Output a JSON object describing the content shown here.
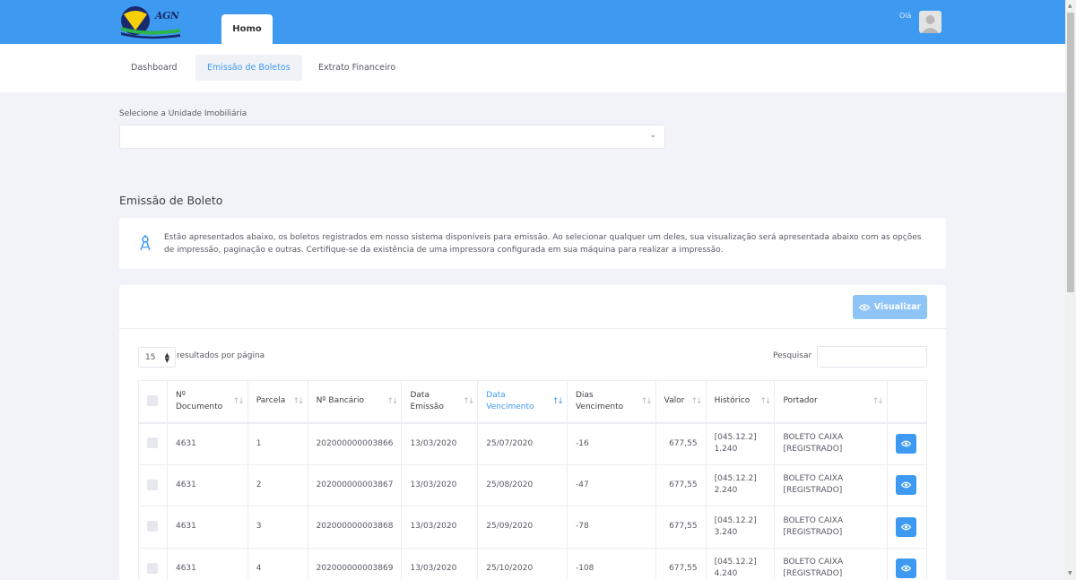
{
  "header": {
    "logo_text": "AGN",
    "home_tab": "Homo",
    "greeting": "Olá"
  },
  "subnav": {
    "items": [
      {
        "label": "Dashboard",
        "active": false
      },
      {
        "label": "Emissão de Boletos",
        "active": true
      },
      {
        "label": "Extrato Financeiro",
        "active": false
      }
    ]
  },
  "unit_select": {
    "label": "Selecione a Unidade Imobiliária",
    "value": ""
  },
  "section_title": "Emissão de Boleto",
  "info": {
    "text": "Estão apresentados abaixo, os boletos registrados em nosso sistema disponíveis para emissão. Ao selecionar qualquer um deles, sua visualização será apresentada abaixo com as opções de impressão, paginação e outras. Certifique-se da existência de uma impressora configurada em sua máquina para realizar a impressão."
  },
  "toolbar": {
    "visualizar_label": "Visualizar"
  },
  "table_controls": {
    "page_size": "15",
    "page_size_label": "resultados por página",
    "search_label": "Pesquisar",
    "search_value": ""
  },
  "table": {
    "columns": [
      {
        "label": "Nº\nDocumento",
        "sorted": false
      },
      {
        "label": "Parcela",
        "sorted": false
      },
      {
        "label": "Nº Bancário",
        "sorted": false
      },
      {
        "label": "Data\nEmissão",
        "sorted": false
      },
      {
        "label": "Data\nVencimento",
        "sorted": true
      },
      {
        "label": "Dias\nVencimento",
        "sorted": false
      },
      {
        "label": "Valor",
        "sorted": false
      },
      {
        "label": "Histórico",
        "sorted": false
      },
      {
        "label": "Portador",
        "sorted": false
      }
    ],
    "rows": [
      {
        "documento": "4631",
        "parcela": "1",
        "bancario": "202000000003866",
        "emissao": "13/03/2020",
        "vencimento": "25/07/2020",
        "dias": "-16",
        "valor": "677,55",
        "historico": "[045.12.2]\n1.240",
        "portador": "BOLETO CAIXA\n[REGISTRADO]"
      },
      {
        "documento": "4631",
        "parcela": "2",
        "bancario": "202000000003867",
        "emissao": "13/03/2020",
        "vencimento": "25/08/2020",
        "dias": "-47",
        "valor": "677,55",
        "historico": "[045.12.2]\n2.240",
        "portador": "BOLETO CAIXA\n[REGISTRADO]"
      },
      {
        "documento": "4631",
        "parcela": "3",
        "bancario": "202000000003868",
        "emissao": "13/03/2020",
        "vencimento": "25/09/2020",
        "dias": "-78",
        "valor": "677,55",
        "historico": "[045.12.2]\n3.240",
        "portador": "BOLETO CAIXA\n[REGISTRADO]"
      },
      {
        "documento": "4631",
        "parcela": "4",
        "bancario": "202000000003869",
        "emissao": "13/03/2020",
        "vencimento": "25/10/2020",
        "dias": "-108",
        "valor": "677,55",
        "historico": "[045.12.2]\n4.240",
        "portador": "BOLETO CAIXA\n[REGISTRADO]"
      }
    ]
  }
}
